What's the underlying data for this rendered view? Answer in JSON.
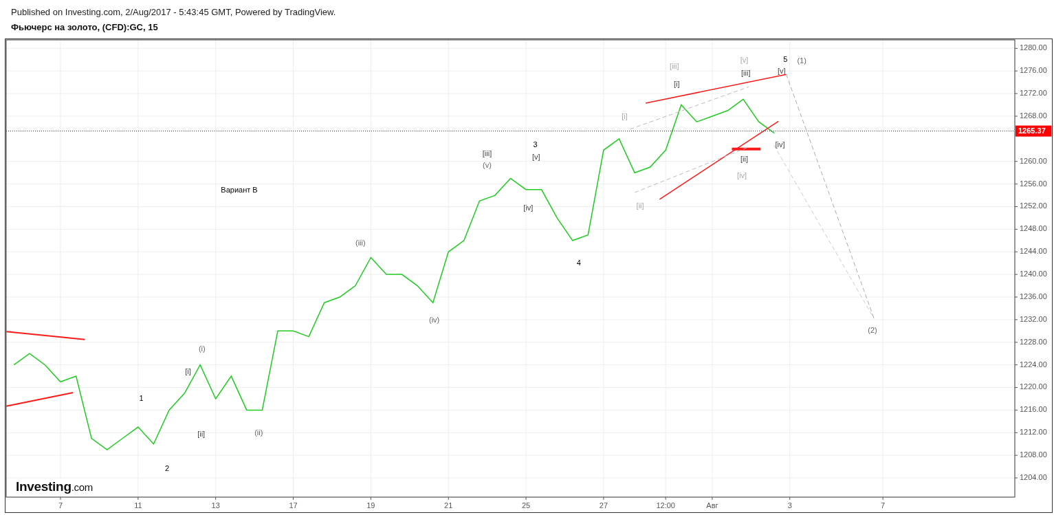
{
  "header": {
    "published": "Published on Investing.com, 2/Aug/2017 - 5:43:45 GMT, Powered by TradingView.",
    "title": "Фьючерс на золото, (CFD):GC, 15"
  },
  "chart": {
    "logo": "**Investing**.com",
    "last_price": "1265.37",
    "chart_data": {
      "type": "line",
      "grid": true,
      "ylim": [
        1200.6,
        1281.5
      ],
      "categories": [
        null,
        null,
        null,
        "7",
        null,
        null,
        null,
        null,
        "11",
        null,
        null,
        null,
        null,
        "13",
        null,
        null,
        null,
        null,
        "17",
        null,
        null,
        null,
        null,
        "19",
        null,
        null,
        null,
        null,
        "21",
        null,
        null,
        null,
        null,
        "25",
        null,
        null,
        null,
        null,
        "27",
        null,
        null,
        null,
        "12:00",
        null,
        null,
        "Авг",
        null,
        null,
        null,
        null,
        "3",
        null,
        null,
        null,
        null,
        null,
        "7",
        null,
        null,
        null,
        null,
        null,
        null,
        null,
        null
      ],
      "yticks": [
        {
          "value": 1204,
          "label": "1204.00"
        },
        {
          "value": 1208,
          "label": "1208.00"
        },
        {
          "value": 1212,
          "label": "1212.00"
        },
        {
          "value": 1216,
          "label": "1216.00"
        },
        {
          "value": 1220,
          "label": "1220.00"
        },
        {
          "value": 1224,
          "label": "1224.00"
        },
        {
          "value": 1228,
          "label": "1228.00"
        },
        {
          "value": 1232,
          "label": "1232.00"
        },
        {
          "value": 1236,
          "label": "1236.00"
        },
        {
          "value": 1240,
          "label": "1240.00"
        },
        {
          "value": 1244,
          "label": "1244.00"
        },
        {
          "value": 1248,
          "label": "1248.00"
        },
        {
          "value": 1252,
          "label": "1252.00"
        },
        {
          "value": 1256,
          "label": "1256.00"
        },
        {
          "value": 1260,
          "label": "1260.00"
        },
        {
          "value": 1268,
          "label": "1268.00"
        },
        {
          "value": 1272,
          "label": "1272.00"
        },
        {
          "value": 1276,
          "label": "1276.00"
        },
        {
          "value": 1280,
          "label": "1280.00"
        }
      ],
      "series": [
        {
          "color": "#1fcc1f",
          "values": [
            1224,
            1226,
            1224,
            1221,
            1222,
            1211,
            1209,
            1211,
            1213,
            1210,
            1216,
            1219,
            1224,
            1218,
            1222,
            1216,
            1216,
            1230,
            1230,
            1229,
            1235,
            1236,
            1238,
            1243,
            1240,
            1240,
            1238,
            1235,
            1244,
            1246,
            1253,
            1254,
            1257,
            1255,
            1255,
            1250,
            1246,
            1247,
            1262,
            1264,
            1258,
            1259,
            1262,
            1270,
            1267,
            1268,
            1269,
            1271,
            1267,
            1265,
            null,
            null,
            null,
            null,
            null,
            null,
            null,
            null,
            null,
            null,
            null,
            null,
            null,
            null,
            null
          ]
        }
      ]
    },
    "wave_labels": [
      {
        "text": "Вариант В",
        "kind": "main"
      },
      {
        "text": "1",
        "kind": "main"
      },
      {
        "text": "2",
        "kind": "main"
      },
      {
        "text": "[i]",
        "kind": "minor"
      },
      {
        "text": "(i)",
        "kind": "minute"
      },
      {
        "text": "[ii]",
        "kind": "minor"
      },
      {
        "text": "(ii)",
        "kind": "minute"
      },
      {
        "text": "(iii)",
        "kind": "minute"
      },
      {
        "text": "(iv)",
        "kind": "minute"
      },
      {
        "text": "[iii]",
        "kind": "minor"
      },
      {
        "text": "(v)",
        "kind": "minute"
      },
      {
        "text": "3",
        "kind": "main"
      },
      {
        "text": "[v]",
        "kind": "minor"
      },
      {
        "text": "[iv]",
        "kind": "minor"
      },
      {
        "text": "4",
        "kind": "main"
      },
      {
        "text": "[i]",
        "kind": "alternate"
      },
      {
        "text": "[ii]",
        "kind": "alternate"
      },
      {
        "text": "[iii]",
        "kind": "alternate"
      },
      {
        "text": "[i]",
        "kind": "minor"
      },
      {
        "text": "[v]",
        "kind": "alternate"
      },
      {
        "text": "[iii]",
        "kind": "minor"
      },
      {
        "text": "[ii]",
        "kind": "minor"
      },
      {
        "text": "[iv]",
        "kind": "alternate"
      },
      {
        "text": "5",
        "kind": "main"
      },
      {
        "text": "[v]",
        "kind": "minor"
      },
      {
        "text": "(1)",
        "kind": "minute"
      },
      {
        "text": "[iv]",
        "kind": "minor"
      },
      {
        "text": "(2)",
        "kind": "minute"
      }
    ]
  }
}
